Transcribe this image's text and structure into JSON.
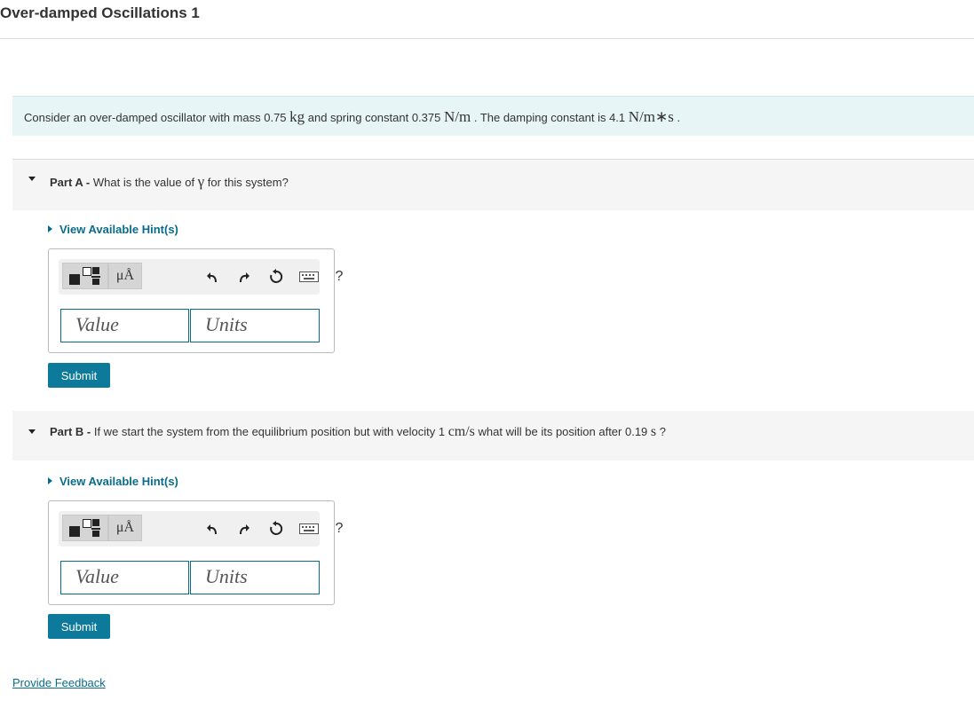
{
  "page": {
    "title": "Over-damped Oscillations 1"
  },
  "intro": {
    "text_1": "Consider an over-damped oscillator with mass 0.75 ",
    "mass_unit": "kg",
    "text_2": " and spring constant 0.375 ",
    "spring_unit": "N/m",
    "text_3": " . The damping constant is 4.1 ",
    "damping_unit": "N/m∗s",
    "text_4": " ."
  },
  "parts": [
    {
      "label": "Part A - ",
      "question_1": "What is the value of ",
      "symbol": "γ",
      "question_2": " for this system?",
      "hint_label": "View Available Hint(s)",
      "value_placeholder": "Value",
      "units_placeholder": "Units",
      "submit_label": "Submit"
    },
    {
      "label": "Part B - ",
      "question_1": "If we start the system from the equilibrium position but with velocity 1 ",
      "velocity_unit": "cm/s",
      "question_2": " what will be its position after 0.19 ",
      "time_unit": "s",
      "question_3": " ?",
      "hint_label": "View Available Hint(s)",
      "value_placeholder": "Value",
      "units_placeholder": "Units",
      "submit_label": "Submit"
    }
  ],
  "toolbar": {
    "units_button_label": "μÅ",
    "help_label": "?",
    "icons": [
      "templates-icon",
      "units-icon",
      "undo-icon",
      "redo-icon",
      "reset-icon",
      "keyboard-icon",
      "help-icon"
    ]
  },
  "footer": {
    "feedback_label": "Provide Feedback"
  },
  "colors": {
    "accent": "#0d7a9b",
    "link": "#0a6c8a",
    "intro_bg": "#e8f5f7",
    "part_header_bg": "#f5f5f5"
  }
}
